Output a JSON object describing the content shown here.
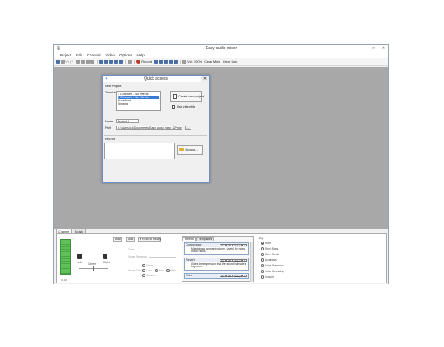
{
  "window": {
    "title": "Easy audio mixer",
    "min": "—",
    "max": "□",
    "close": "✕"
  },
  "menu": [
    "Project",
    "Edit",
    "Channel",
    "Video",
    "Options",
    "Help"
  ],
  "toolbar": {
    "dim_text": "Vb (*)",
    "record": "Record",
    "vol": "Vol: 100%",
    "clear_mute": "Clear Mute",
    "clear_solo": "Clear Solo"
  },
  "dialog": {
    "title": "Quick access",
    "close": "✕",
    "new_project": "New Project",
    "template_label": "Template",
    "templates": [
      "1 Channels - No effects",
      "2 Channels - No effects",
      "Broadcast",
      "Singing"
    ],
    "selected_index": 1,
    "create_new_project": "Create new project",
    "use_video_file": "Use video file",
    "name_label": "Name",
    "name_value": "Project 1",
    "path_label": "Path",
    "path_value": "C:\\Users\\c4\\Documents\\Easy audio mixer 2\\Project 1",
    "path_browse": "...",
    "recent_label": "Recent",
    "browse": "Browse..."
  },
  "bottom": {
    "tabs": [
      "Channel",
      "Music"
    ],
    "active_tab": 0,
    "vol_readout": "0.00",
    "left": "Left",
    "center": "Center",
    "right": "Right",
    "mute": "Mute",
    "solo": "Solo",
    "record_ready": "● Record Ready",
    "tone": "Tone",
    "voice_removal": "Voice Removal",
    "voice_gain": "Voice Gain",
    "gain_none": "None",
    "gain_low": "Low",
    "gain_mid": "Mid",
    "gain_high": "High",
    "gain_custom": "Custom",
    "effects_tabs": [
      "Effects",
      "Templates"
    ],
    "effects": [
      {
        "title": "Compressor",
        "desc": "Maintains a constant volume. Useful for noisy vocal tracks."
      },
      {
        "title": "Reverb",
        "desc": "Gives the impression that the sound is inside a big room."
      },
      {
        "title": "Echo",
        "desc": ""
      }
    ],
    "effect_buttons": [
      "On",
      "Off",
      "Setup",
      "X"
    ],
    "eq_label": "EQ",
    "eq_options": [
      "None",
      "More Bass",
      "More Treble",
      "Loudness",
      "Voice Presence",
      "Voice Deessing",
      "Custom"
    ],
    "eq_selected": 0
  }
}
